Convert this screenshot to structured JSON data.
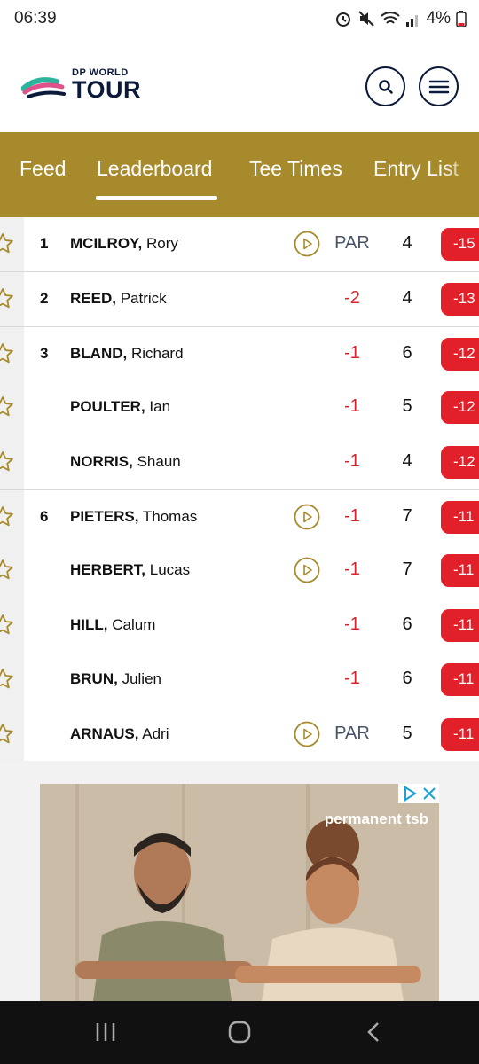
{
  "status": {
    "time": "06:39",
    "battery": "4%"
  },
  "header": {
    "logo_top": "DP WORLD",
    "logo_bottom": "TOUR"
  },
  "tabs": [
    {
      "label": "Feed"
    },
    {
      "label": "Leaderboard",
      "active": true
    },
    {
      "label": "Tee Times"
    },
    {
      "label": "Entry List"
    }
  ],
  "leaderboard": {
    "rows": [
      {
        "pos": "1",
        "last": "MCILROY,",
        "first": "Rory",
        "video": true,
        "today": "PAR",
        "thru": "4",
        "total": "-15"
      },
      {
        "pos": "2",
        "last": "REED,",
        "first": "Patrick",
        "video": false,
        "today": "-2",
        "thru": "4",
        "total": "-13"
      },
      {
        "pos": "3",
        "last": "BLAND,",
        "first": "Richard",
        "video": false,
        "today": "-1",
        "thru": "6",
        "total": "-12"
      },
      {
        "pos": "",
        "last": "POULTER,",
        "first": "Ian",
        "video": false,
        "today": "-1",
        "thru": "5",
        "total": "-12"
      },
      {
        "pos": "",
        "last": "NORRIS,",
        "first": "Shaun",
        "video": false,
        "today": "-1",
        "thru": "4",
        "total": "-12"
      },
      {
        "pos": "6",
        "last": "PIETERS,",
        "first": "Thomas",
        "video": true,
        "today": "-1",
        "thru": "7",
        "total": "-11"
      },
      {
        "pos": "",
        "last": "HERBERT,",
        "first": "Lucas",
        "video": true,
        "today": "-1",
        "thru": "7",
        "total": "-11"
      },
      {
        "pos": "",
        "last": "HILL,",
        "first": "Calum",
        "video": false,
        "today": "-1",
        "thru": "6",
        "total": "-11"
      },
      {
        "pos": "",
        "last": "BRUN,",
        "first": "Julien",
        "video": false,
        "today": "-1",
        "thru": "6",
        "total": "-11"
      },
      {
        "pos": "",
        "last": "ARNAUS,",
        "first": "Adri",
        "video": true,
        "today": "PAR",
        "thru": "5",
        "total": "-11"
      }
    ]
  },
  "ad": {
    "brand": "permanent tsb"
  },
  "colors": {
    "gold": "#a78a2c",
    "navy": "#0b1a3a",
    "red": "#e2202a"
  }
}
